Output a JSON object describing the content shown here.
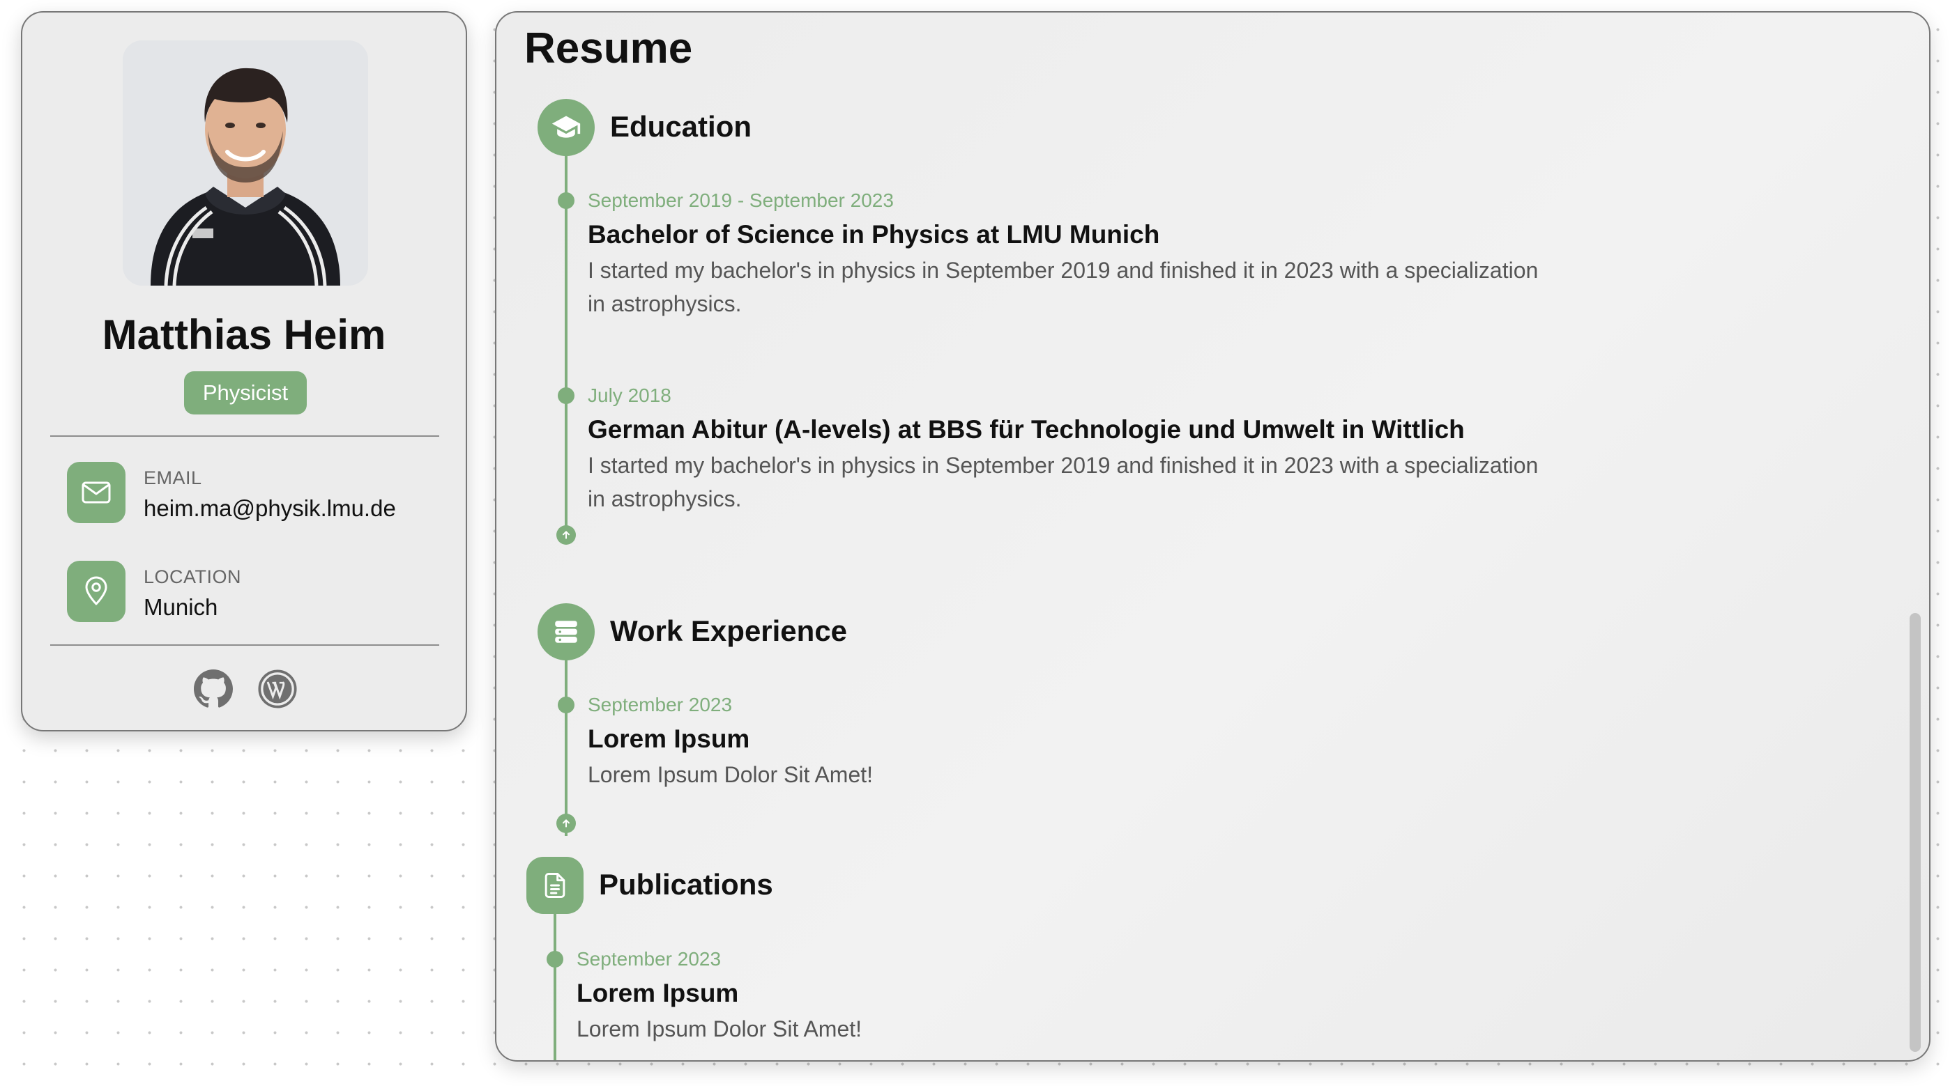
{
  "profile": {
    "name": "Matthias Heim",
    "role": "Physicist",
    "contacts": [
      {
        "label": "EMAIL",
        "value": "heim.ma@physik.lmu.de",
        "icon": "mail-icon"
      },
      {
        "label": "LOCATION",
        "value": "Munich",
        "icon": "map-pin-icon"
      }
    ],
    "social": [
      {
        "name": "github",
        "icon": "github-icon"
      },
      {
        "name": "wordpress",
        "icon": "wordpress-icon"
      }
    ]
  },
  "resume": {
    "title": "Resume",
    "sections": [
      {
        "title": "Education",
        "icon": "graduation-cap-icon",
        "entries": [
          {
            "date": "September 2019 - September 2023",
            "title": "Bachelor of Science in Physics at LMU Munich",
            "description_lines": [
              "I started my bachelor's in physics in September 2019 and finished it in 2023 with a specialization",
              "in astrophysics."
            ]
          },
          {
            "date": "July 2018",
            "title": "German Abitur (A-levels) at BBS für Technologie und Umwelt in Wittlich",
            "description_lines": [
              "I started my bachelor's in physics in September 2019 and finished it in 2023 with a specialization",
              "in astrophysics."
            ]
          }
        ]
      },
      {
        "title": "Work Experience",
        "icon": "server-stack-icon",
        "entries": [
          {
            "date": "September 2023",
            "title": "Lorem Ipsum",
            "description_lines": [
              "Lorem Ipsum Dolor Sit Amet!"
            ]
          }
        ]
      },
      {
        "title": "Publications",
        "icon": "document-icon",
        "entries": [
          {
            "date": "September 2023",
            "title": "Lorem Ipsum",
            "description_lines": [
              "Lorem Ipsum Dolor Sit Amet!"
            ]
          }
        ]
      }
    ]
  },
  "colors": {
    "accent": "#7fae7c",
    "panel_background": "#ececec",
    "border": "#777777"
  }
}
